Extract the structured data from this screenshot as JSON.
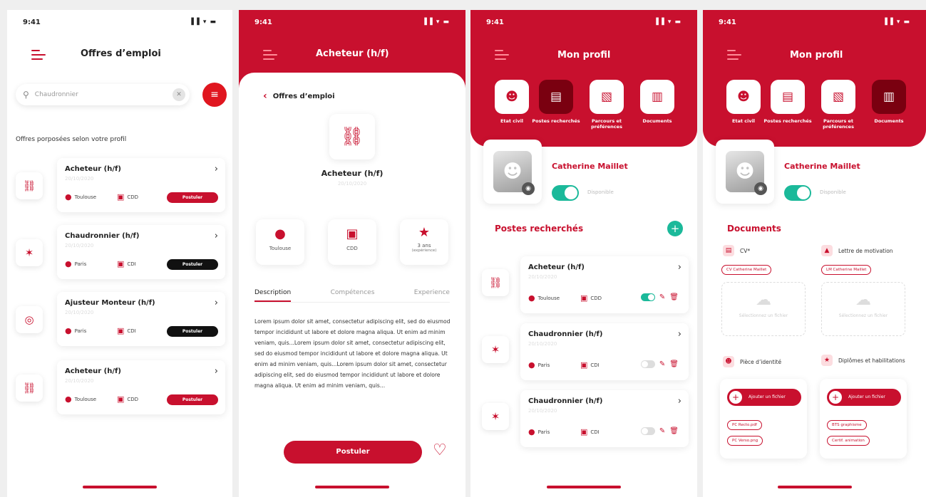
{
  "status_time": "9:41",
  "status_icons": "▐▐ ▾ ▬",
  "screen1": {
    "title": "Offres d’emploi",
    "search_value": "Chaudronnier",
    "section_label": "Offres porposées selon votre profil",
    "jobs": [
      {
        "title": "Acheteur (h/f)",
        "date": "20/10/2020",
        "location": "Toulouse",
        "contract": "CDD",
        "apply": "Postuler",
        "apply_color": "#c8102e",
        "icon": "truck-icon"
      },
      {
        "title": "Chaudronnier (h/f)",
        "date": "20/10/2020",
        "location": "Paris",
        "contract": "CDI",
        "apply": "Postuler",
        "apply_color": "#111111",
        "icon": "star-icon"
      },
      {
        "title": "Ajusteur Monteur (h/f)",
        "date": "20/10/2020",
        "location": "Paris",
        "contract": "CDI",
        "apply": "Postuler",
        "apply_color": "#111111",
        "icon": "target-icon"
      },
      {
        "title": "Acheteur (h/f)",
        "date": "20/10/2020",
        "location": "Toulouse",
        "contract": "CDD",
        "apply": "Postuler",
        "apply_color": "#c8102e",
        "icon": "truck-icon"
      }
    ]
  },
  "screen2": {
    "title": "Acheteur (h/f)",
    "back_label": "Offres d’emploi",
    "job_title": "Acheteur (h/f)",
    "job_date": "20/10/2020",
    "info": [
      {
        "label": "Toulouse"
      },
      {
        "label": "CDD"
      },
      {
        "label": "3 ans",
        "sub": "(expérience)"
      }
    ],
    "tabs": [
      "Description",
      "Compétences",
      "Experience"
    ],
    "description": "Lorem ipsum dolor sit amet, consectetur adipiscing elit, sed do eiusmod tempor incididunt ut labore et dolore magna aliqua. Ut enim ad minim veniam, quis...Lorem ipsum dolor sit amet, consectetur adipiscing elit, sed do eiusmod tempor incididunt ut labore et dolore magna aliqua. Ut enim ad minim veniam, quis...Lorem ipsum dolor sit amet, consectetur adipiscing elit, sed do eiusmod tempor incididunt ut labore et dolore magna aliqua. Ut enim ad minim veniam, quis...",
    "apply": "Postuler"
  },
  "profile_header": {
    "title": "Mon profil",
    "categories": [
      "Etat civil",
      "Postes recherchés",
      "Parcours et préférences",
      "Documents"
    ]
  },
  "profile": {
    "name": "Catherine Maillet",
    "availability": "Disponible"
  },
  "screen3": {
    "section": "Postes recherchés",
    "jobs": [
      {
        "title": "Acheteur (h/f)",
        "date": "20/10/2020",
        "location": "Toulouse",
        "contract": "CDD",
        "active": true
      },
      {
        "title": "Chaudronnier (h/f)",
        "date": "20/10/2020",
        "location": "Paris",
        "contract": "CDI",
        "active": false
      },
      {
        "title": "Chaudronnier (h/f)",
        "date": "20/10/2020",
        "location": "Paris",
        "contract": "CDI",
        "active": false
      }
    ]
  },
  "screen4": {
    "section": "Documents",
    "cv_label": "CV*",
    "cv_chip": "CV Catherine Maillet",
    "letter_label": "Lettre de motivation",
    "letter_chip": "LM Catherine Maillet",
    "dropzone_text": "Sélectionnez un fichier",
    "id_label": "Pièce d’identité",
    "diplomas_label": "Diplômes et habilitations",
    "add_file": "Ajouter un fichier",
    "id_files": [
      "PC Recto.pdf",
      "PC Verso.png"
    ],
    "diploma_files": [
      "BTS graphisme",
      "Certif. animation"
    ]
  }
}
